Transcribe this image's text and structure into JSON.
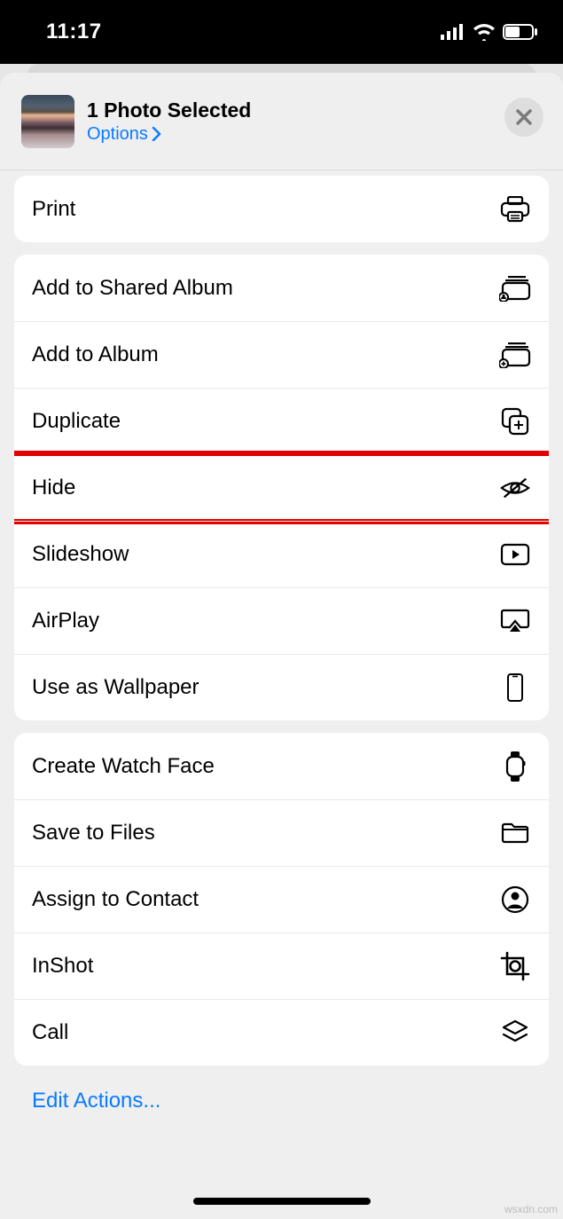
{
  "status": {
    "time": "11:17"
  },
  "header": {
    "title": "1 Photo Selected",
    "options": "Options"
  },
  "groups": {
    "g1": {
      "print": "Print"
    },
    "g2": {
      "add_shared": "Add to Shared Album",
      "add_album": "Add to Album",
      "duplicate": "Duplicate",
      "hide": "Hide",
      "slideshow": "Slideshow",
      "airplay": "AirPlay",
      "wallpaper": "Use as Wallpaper"
    },
    "g3": {
      "watchface": "Create Watch Face",
      "save_files": "Save to Files",
      "assign_contact": "Assign to Contact",
      "inshot": "InShot",
      "call": "Call"
    }
  },
  "footer": {
    "edit_actions": "Edit Actions..."
  },
  "watermark": "wsxdn.com"
}
